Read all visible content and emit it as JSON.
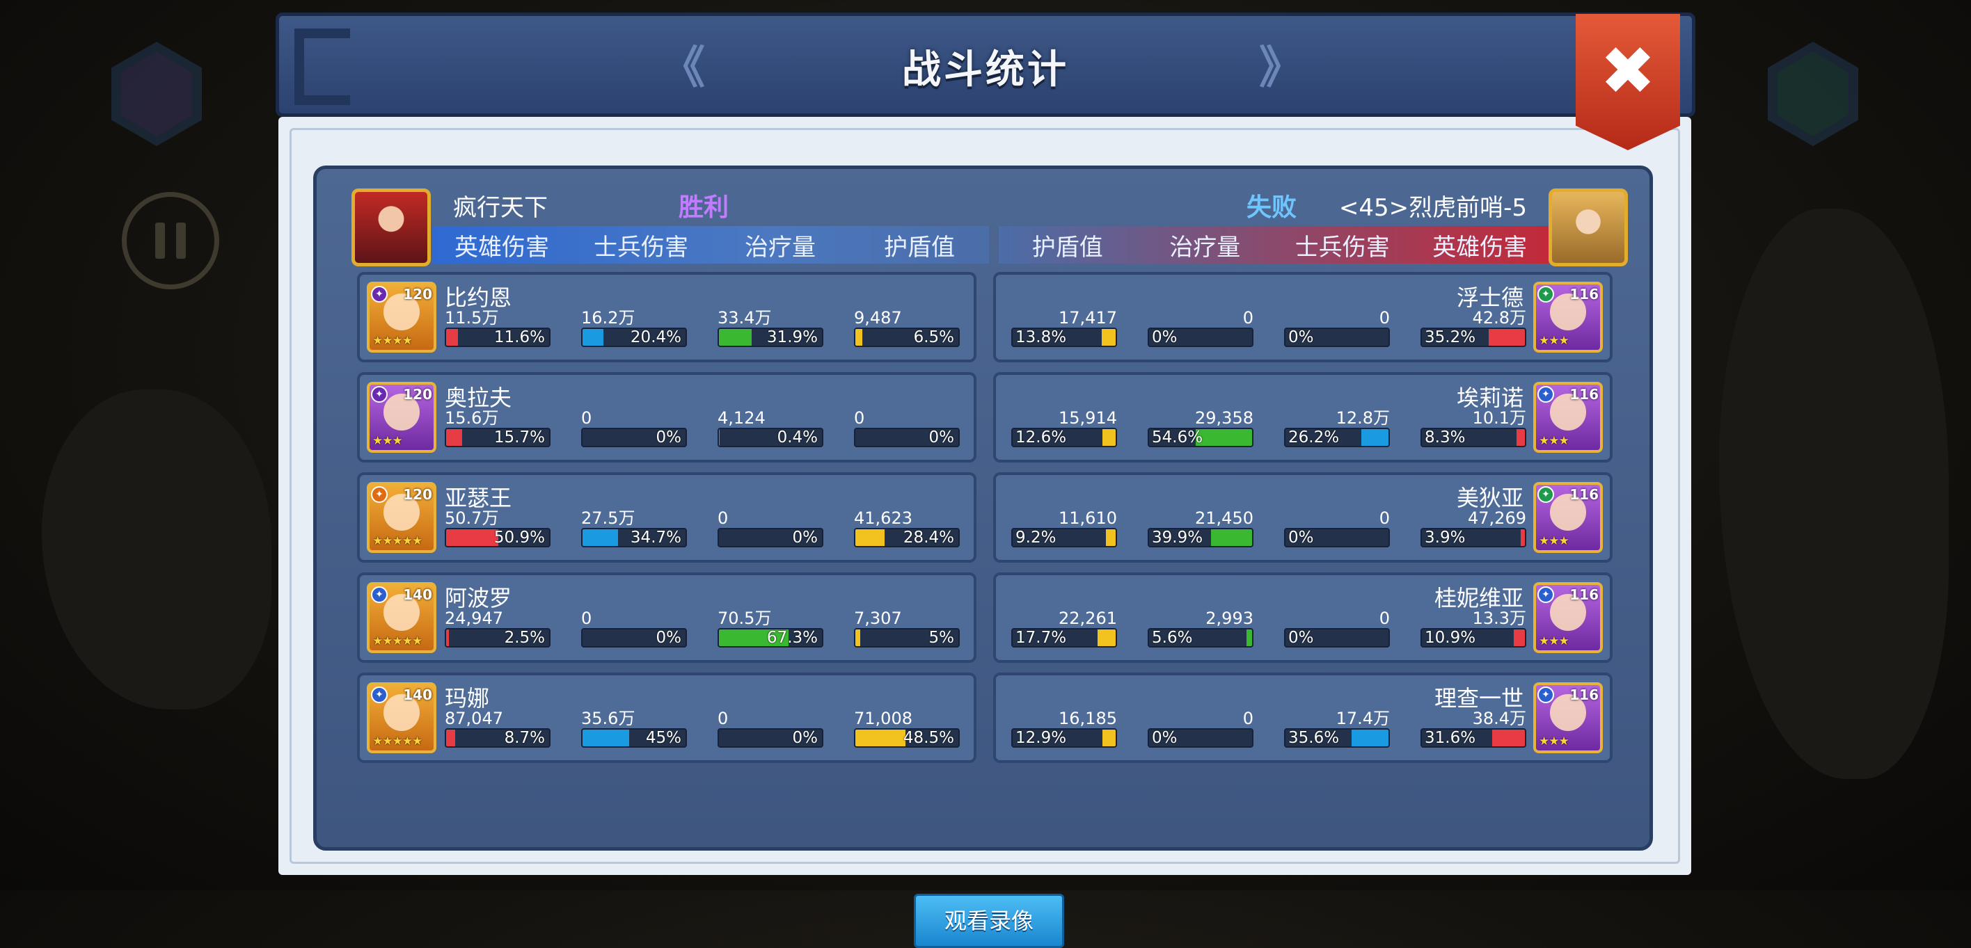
{
  "window": {
    "title": "战斗统计",
    "close_label": "✖",
    "prev_label": "《",
    "next_label": "》"
  },
  "colors": {
    "hero_dmg": "#e83c44",
    "troop_dmg": "#1a9ae0",
    "heal": "#3bb832",
    "shield": "#f2c21e"
  },
  "left_team": {
    "name": "疯行天下",
    "result": "胜利",
    "result_color": "#c27dff",
    "headers": [
      "英雄伤害",
      "士兵伤害",
      "治疗量",
      "护盾值"
    ],
    "heroes": [
      {
        "name": "比约恩",
        "level": "120",
        "class": "purple",
        "frame": "gold",
        "stars": "★★★★",
        "stats": [
          {
            "value": "11.5万",
            "pct": "11.6%",
            "ratio": 0.116
          },
          {
            "value": "16.2万",
            "pct": "20.4%",
            "ratio": 0.204
          },
          {
            "value": "33.4万",
            "pct": "31.9%",
            "ratio": 0.319
          },
          {
            "value": "9,487",
            "pct": "6.5%",
            "ratio": 0.065
          }
        ]
      },
      {
        "name": "奥拉夫",
        "level": "120",
        "class": "purple",
        "frame": "purple",
        "stars": "★★★",
        "stats": [
          {
            "value": "15.6万",
            "pct": "15.7%",
            "ratio": 0.157
          },
          {
            "value": "0",
            "pct": "0%",
            "ratio": 0
          },
          {
            "value": "4,124",
            "pct": "0.4%",
            "ratio": 0.004
          },
          {
            "value": "0",
            "pct": "0%",
            "ratio": 0
          }
        ]
      },
      {
        "name": "亚瑟王",
        "level": "120",
        "class": "orange",
        "frame": "gold",
        "stars": "★★★★★",
        "stats": [
          {
            "value": "50.7万",
            "pct": "50.9%",
            "ratio": 0.509
          },
          {
            "value": "27.5万",
            "pct": "34.7%",
            "ratio": 0.347
          },
          {
            "value": "0",
            "pct": "0%",
            "ratio": 0
          },
          {
            "value": "41,623",
            "pct": "28.4%",
            "ratio": 0.284
          }
        ]
      },
      {
        "name": "阿波罗",
        "level": "140",
        "class": "blue",
        "frame": "gold",
        "stars": "★★★★★",
        "stats": [
          {
            "value": "24,947",
            "pct": "2.5%",
            "ratio": 0.025
          },
          {
            "value": "0",
            "pct": "0%",
            "ratio": 0
          },
          {
            "value": "70.5万",
            "pct": "67.3%",
            "ratio": 0.673
          },
          {
            "value": "7,307",
            "pct": "5%",
            "ratio": 0.05
          }
        ]
      },
      {
        "name": "玛娜",
        "level": "140",
        "class": "blue",
        "frame": "gold",
        "stars": "★★★★★",
        "stats": [
          {
            "value": "87,047",
            "pct": "8.7%",
            "ratio": 0.087
          },
          {
            "value": "35.6万",
            "pct": "45%",
            "ratio": 0.45
          },
          {
            "value": "0",
            "pct": "0%",
            "ratio": 0
          },
          {
            "value": "71,008",
            "pct": "48.5%",
            "ratio": 0.485
          }
        ]
      }
    ]
  },
  "right_team": {
    "name": "<45>烈虎前哨-5",
    "result": "失败",
    "result_color": "#6fc6ff",
    "headers": [
      "护盾值",
      "治疗量",
      "士兵伤害",
      "英雄伤害"
    ],
    "heroes": [
      {
        "name": "浮士德",
        "level": "116",
        "class": "green",
        "frame": "purple",
        "stars": "★★★",
        "stats": [
          {
            "value": "17,417",
            "pct": "13.8%",
            "ratio": 0.138
          },
          {
            "value": "0",
            "pct": "0%",
            "ratio": 0
          },
          {
            "value": "0",
            "pct": "0%",
            "ratio": 0
          },
          {
            "value": "42.8万",
            "pct": "35.2%",
            "ratio": 0.352
          }
        ]
      },
      {
        "name": "埃莉诺",
        "level": "116",
        "class": "blue",
        "frame": "purple",
        "stars": "★★★",
        "stats": [
          {
            "value": "15,914",
            "pct": "12.6%",
            "ratio": 0.126
          },
          {
            "value": "29,358",
            "pct": "54.6%",
            "ratio": 0.546
          },
          {
            "value": "12.8万",
            "pct": "26.2%",
            "ratio": 0.262
          },
          {
            "value": "10.1万",
            "pct": "8.3%",
            "ratio": 0.083
          }
        ]
      },
      {
        "name": "美狄亚",
        "level": "116",
        "class": "green",
        "frame": "purple",
        "stars": "★★★",
        "stats": [
          {
            "value": "11,610",
            "pct": "9.2%",
            "ratio": 0.092
          },
          {
            "value": "21,450",
            "pct": "39.9%",
            "ratio": 0.399
          },
          {
            "value": "0",
            "pct": "0%",
            "ratio": 0
          },
          {
            "value": "47,269",
            "pct": "3.9%",
            "ratio": 0.039
          }
        ]
      },
      {
        "name": "桂妮维亚",
        "level": "116",
        "class": "blue",
        "frame": "purple",
        "stars": "★★★",
        "stats": [
          {
            "value": "22,261",
            "pct": "17.7%",
            "ratio": 0.177
          },
          {
            "value": "2,993",
            "pct": "5.6%",
            "ratio": 0.056
          },
          {
            "value": "0",
            "pct": "0%",
            "ratio": 0
          },
          {
            "value": "13.3万",
            "pct": "10.9%",
            "ratio": 0.109
          }
        ]
      },
      {
        "name": "理查一世",
        "level": "116",
        "class": "blue",
        "frame": "purple",
        "stars": "★★★",
        "stats": [
          {
            "value": "16,185",
            "pct": "12.9%",
            "ratio": 0.129
          },
          {
            "value": "0",
            "pct": "0%",
            "ratio": 0
          },
          {
            "value": "17.4万",
            "pct": "35.6%",
            "ratio": 0.356
          },
          {
            "value": "38.4万",
            "pct": "31.6%",
            "ratio": 0.316
          }
        ]
      }
    ]
  },
  "replay_button": "观看录像"
}
